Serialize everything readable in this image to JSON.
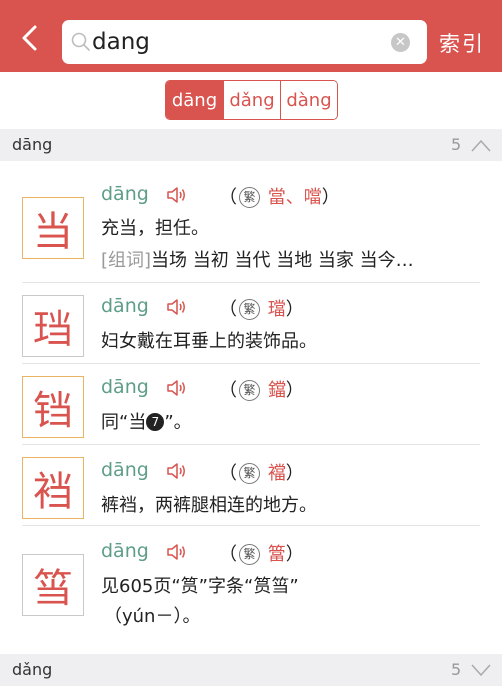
{
  "header": {
    "search_value": "dang",
    "index_label": "索引"
  },
  "tone_tabs": [
    {
      "label": "dāng",
      "active": true
    },
    {
      "label": "dǎng",
      "active": false
    },
    {
      "label": "dàng",
      "active": false
    }
  ],
  "sections": [
    {
      "pinyin": "dāng",
      "count": "5",
      "expanded": true
    },
    {
      "pinyin": "dǎng",
      "count": "5",
      "expanded": false
    }
  ],
  "entries": [
    {
      "char": "当",
      "pinyin": "dāng",
      "traditional_mark": "繁",
      "traditional": "當、噹",
      "definition": "充当，担任。",
      "words_tag": "[组词]",
      "words": "当场 当初 当代 当地 当家 当今…"
    },
    {
      "char": "珰",
      "pinyin": "dāng",
      "traditional_mark": "繁",
      "traditional": "璫",
      "definition": "妇女戴在耳垂上的装饰品。"
    },
    {
      "char": "铛",
      "pinyin": "dāng",
      "traditional_mark": "繁",
      "traditional": "鐺",
      "definition_pre": "同“当",
      "definition_num": "7",
      "definition_post": "”。"
    },
    {
      "char": "裆",
      "pinyin": "dāng",
      "traditional_mark": "繁",
      "traditional": "襠",
      "definition": "裤裆，两裤腿相连的地方。"
    },
    {
      "char": "筜",
      "pinyin": "dāng",
      "traditional_mark": "繁",
      "traditional": "簹",
      "definition": "见605页“筼”字条“筼筜”",
      "definition_line2": "（yún－）。"
    }
  ],
  "colors": {
    "brand_red": "#d9544f",
    "pinyin_green": "#5e9e89",
    "highlight_border": "#e9b463"
  }
}
